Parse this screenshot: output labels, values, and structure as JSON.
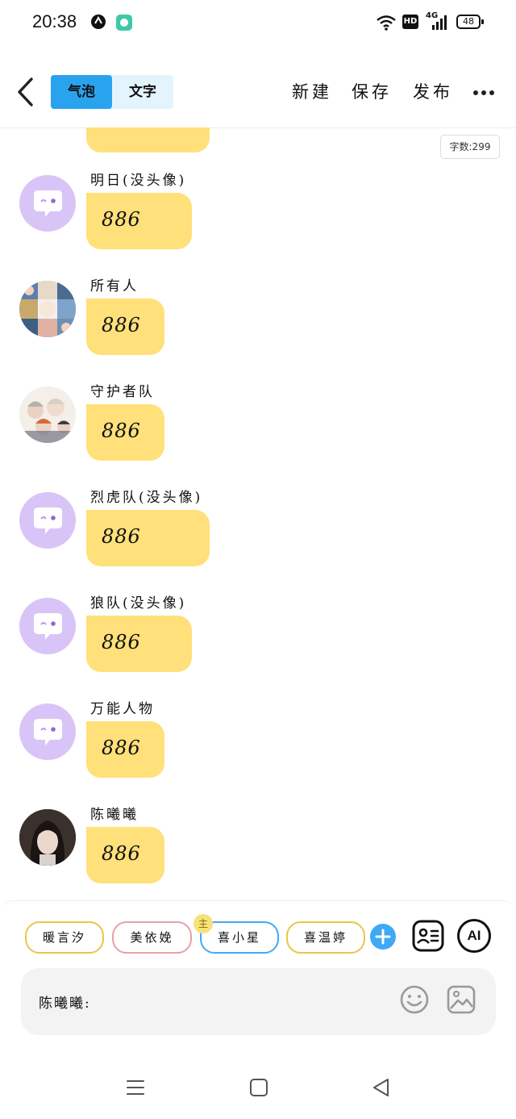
{
  "status_bar": {
    "time": "20:38",
    "network": "4G",
    "hd": "HD",
    "battery": "48"
  },
  "header": {
    "tabs": [
      "气泡",
      "文字"
    ],
    "actions": [
      "新建",
      "保存",
      "发布"
    ]
  },
  "word_count": "字数:299",
  "messages": [
    {
      "name": "明日(没头像)",
      "text": "886",
      "avatar": "speech-bubble-icon"
    },
    {
      "name": "所有人",
      "text": "886",
      "avatar": "group-collage"
    },
    {
      "name": "守护者队",
      "text": "886",
      "avatar": "anime-group"
    },
    {
      "name": "烈虎队(没头像)",
      "text": "886",
      "avatar": "speech-bubble-icon"
    },
    {
      "name": "狼队(没头像)",
      "text": "886",
      "avatar": "speech-bubble-icon"
    },
    {
      "name": "万能人物",
      "text": "886",
      "avatar": "speech-bubble-icon"
    },
    {
      "name": "陈曦曦",
      "text": "886",
      "avatar": "photo-girl"
    }
  ],
  "characters": [
    {
      "name": "暖言汐",
      "color": "#e8c64a"
    },
    {
      "name": "美依娩",
      "color": "#e8a0a8"
    },
    {
      "name": "喜小星",
      "color": "#3fa9f5",
      "badge": "主"
    },
    {
      "name": "喜温婷",
      "color": "#e8c64a"
    }
  ],
  "input": {
    "speaker_label": "陈曦曦:"
  },
  "colors": {
    "accent": "#2aa3ef",
    "bubble": "#ffe07a",
    "avatar_placeholder": "#d9c4f7"
  }
}
